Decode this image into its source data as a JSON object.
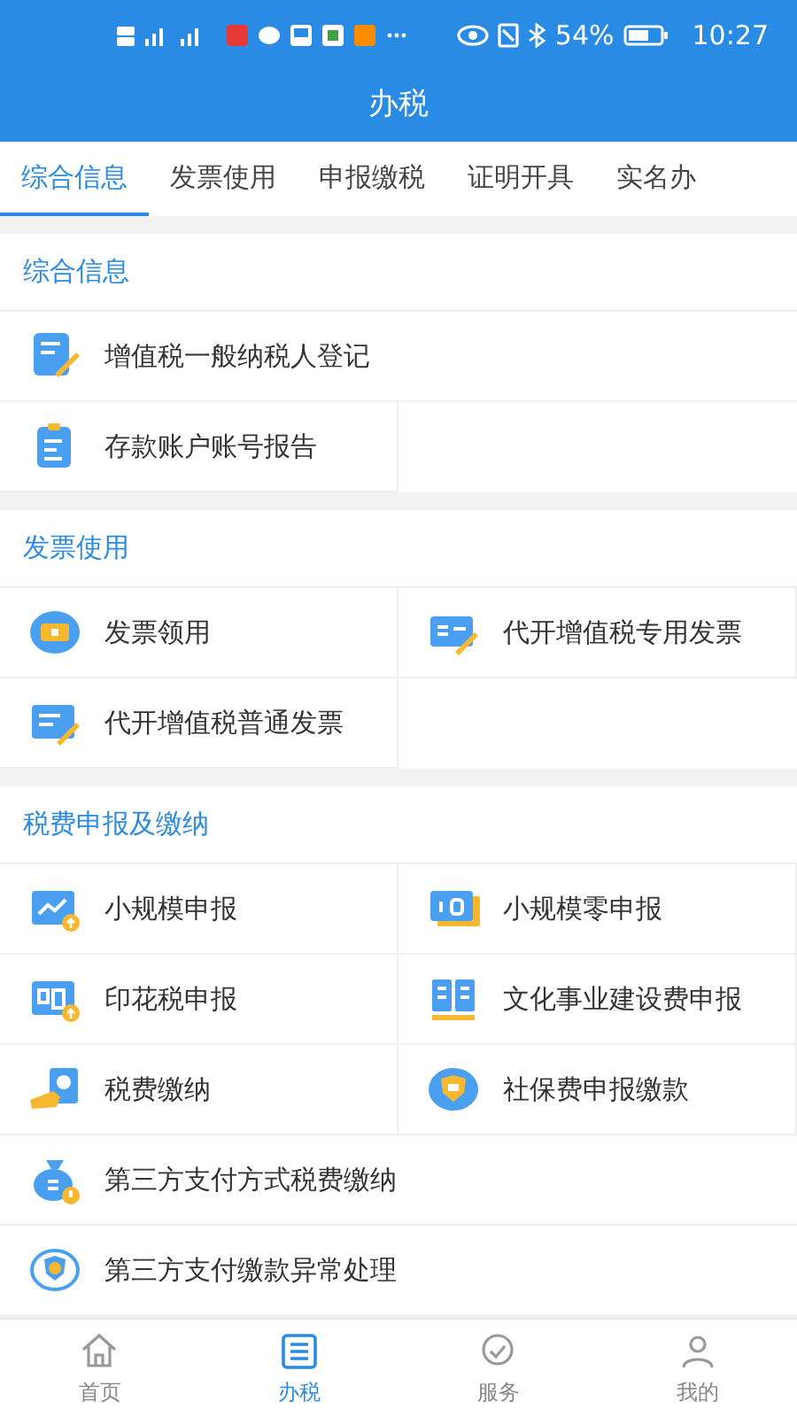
{
  "status_bar": {
    "battery": "54%",
    "time": "10:27"
  },
  "header": {
    "title": "办税"
  },
  "tabs": [
    {
      "label": "综合信息",
      "selected": true
    },
    {
      "label": "发票使用",
      "selected": false
    },
    {
      "label": "申报缴税",
      "selected": false
    },
    {
      "label": "证明开具",
      "selected": false
    },
    {
      "label": "实名办",
      "selected": false
    }
  ],
  "sections": [
    {
      "title": "综合信息",
      "items": [
        {
          "label": "增值税一般纳税人登记",
          "kind": "wide"
        },
        {
          "label": "存款账户账号报告",
          "kind": "half"
        }
      ]
    },
    {
      "title": "发票使用",
      "items": [
        {
          "label": "发票领用",
          "kind": "half"
        },
        {
          "label": "代开增值税专用发票",
          "kind": "half"
        },
        {
          "label": "代开增值税普通发票",
          "kind": "half"
        }
      ]
    },
    {
      "title": "税费申报及缴纳",
      "items": [
        {
          "label": "小规模申报",
          "kind": "half"
        },
        {
          "label": "小规模零申报",
          "kind": "half"
        },
        {
          "label": "印花税申报",
          "kind": "half"
        },
        {
          "label": "文化事业建设费申报",
          "kind": "half"
        },
        {
          "label": "税费缴纳",
          "kind": "half"
        },
        {
          "label": "社保费申报缴款",
          "kind": "half"
        },
        {
          "label": "第三方支付方式税费缴纳",
          "kind": "wide"
        },
        {
          "label": "第三方支付缴款异常处理",
          "kind": "wide"
        }
      ]
    }
  ],
  "bottom_nav": [
    {
      "label": "首页",
      "selected": false
    },
    {
      "label": "办税",
      "selected": true
    },
    {
      "label": "服务",
      "selected": false
    },
    {
      "label": "我的",
      "selected": false
    }
  ]
}
